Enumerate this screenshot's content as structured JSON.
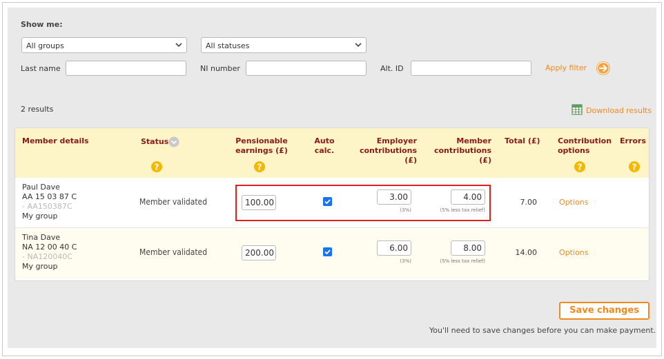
{
  "filters": {
    "show_me_label": "Show me:",
    "group_select": "All groups",
    "status_select": "All statuses",
    "last_name_label": "Last name",
    "ni_number_label": "NI number",
    "alt_id_label": "Alt. ID",
    "apply_label": "Apply filter"
  },
  "results": {
    "count_text": "2 results",
    "download_label": "Download results"
  },
  "table": {
    "headers": {
      "member_details": "Member details",
      "status": "Status",
      "pensionable_1": "Pensionable",
      "pensionable_2": "earnings (£)",
      "auto_1": "Auto",
      "auto_2": "calc.",
      "employer_1": "Employer",
      "employer_2": "contributions (£)",
      "member_1": "Member",
      "member_2": "contributions (£)",
      "total": "Total (£)",
      "contribution_1": "Contribution",
      "contribution_2": "options",
      "errors": "Errors"
    },
    "rows": [
      {
        "name": "Paul Dave",
        "ni": "AA 15 03 87 C",
        "alt_id": "- AA150387C",
        "group": "My group",
        "status": "Member validated",
        "pensionable": "100.00",
        "employer": "3.00",
        "employer_note": "(3%)",
        "member": "4.00",
        "member_note": "(5% less tax relief)",
        "total": "7.00",
        "options": "Options"
      },
      {
        "name": "Tina Dave",
        "ni": "NA 12 00 40 C",
        "alt_id": "- NA120040C",
        "group": "My group",
        "status": "Member validated",
        "pensionable": "200.00",
        "employer": "6.00",
        "employer_note": "(3%)",
        "member": "8.00",
        "member_note": "(5% less tax relief)",
        "total": "14.00",
        "options": "Options"
      }
    ]
  },
  "actions": {
    "save_label": "Save changes",
    "save_note": "You'll need to save changes before you can make payment."
  },
  "colors": {
    "accent": "#f08a1c",
    "header_bg": "#fdf5c8",
    "header_text": "#8a1a1a",
    "checkbox": "#1a73e8",
    "highlight": "#e0201e"
  }
}
